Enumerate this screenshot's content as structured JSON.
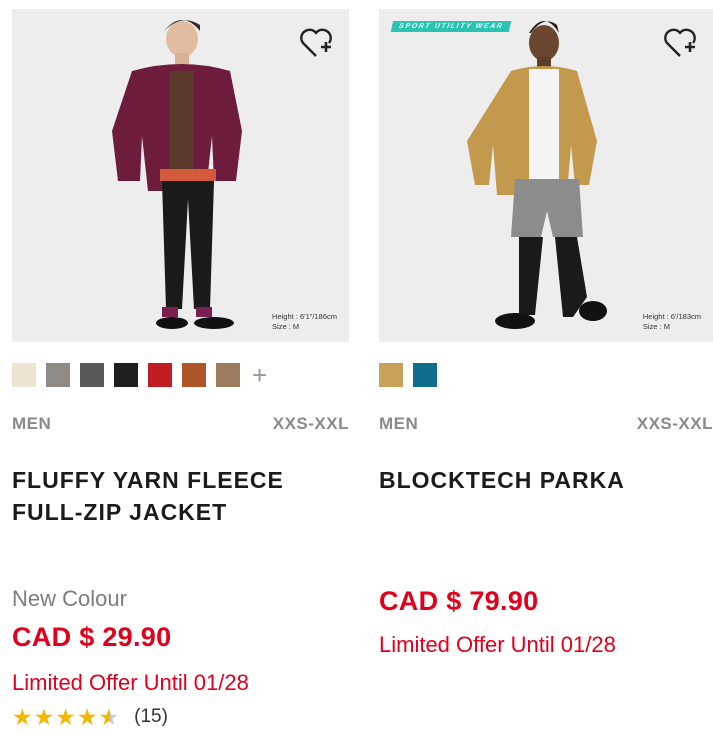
{
  "products": [
    {
      "wishlist_icon": "heart-plus-icon",
      "model_info": [
        "Height : 6'1\"/186cm",
        "Size : M"
      ],
      "colors": [
        "#ece3d3",
        "#8f8a86",
        "#5a5858",
        "#1f1f1f",
        "#c01c22",
        "#b0542a",
        "#9c7b5e"
      ],
      "more_colors_icon": "+",
      "gender": "MEN",
      "sizes": "XXS-XXL",
      "name_line1": "FLUFFY YARN FLEECE",
      "name_line2": "FULL-ZIP JACKET",
      "flag": "New Colour",
      "price": "CAD $ 29.90",
      "offer": "Limited Offer Until 01/28",
      "rating": 4.5,
      "review_count": "(15)"
    },
    {
      "wishlist_icon": "heart-plus-icon",
      "badge": "SPORT UTILITY WEAR",
      "model_info": [
        "Height : 6'/183cm",
        "Size : M"
      ],
      "colors": [
        "#c9a25a",
        "#0e6e8c"
      ],
      "gender": "MEN",
      "sizes": "XXS-XXL",
      "name_line1": "BLOCKTECH PARKA",
      "price": "CAD $ 79.90",
      "offer": "Limited Offer Until 01/28"
    }
  ],
  "colors": {
    "price_red": "#e0001c",
    "meta_gray": "#8a8a8a",
    "badge_teal": "#29c4b3"
  }
}
